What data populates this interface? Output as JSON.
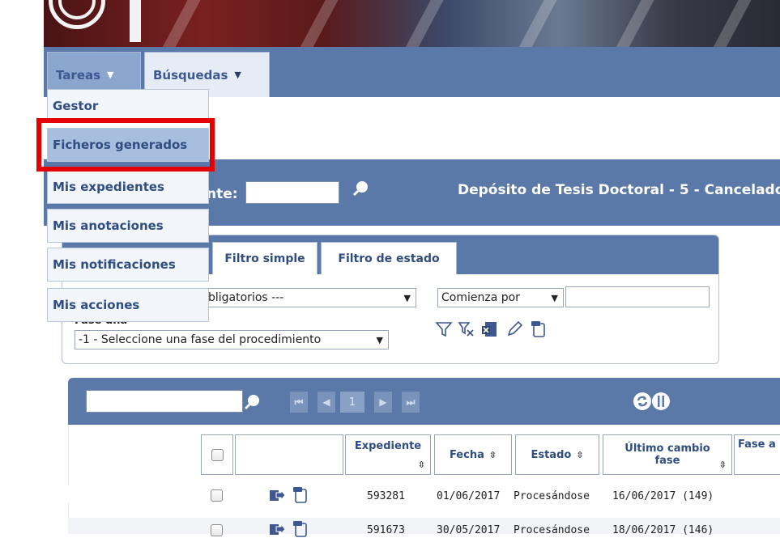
{
  "nav": {
    "tabs": [
      {
        "label": "Tareas"
      },
      {
        "label": "Búsquedas"
      }
    ],
    "caret": "▼"
  },
  "dropdown": {
    "items": [
      {
        "label": "Gestor"
      },
      {
        "label": "Ficheros generados"
      },
      {
        "label": "Mis expedientes"
      },
      {
        "label": "Mis anotaciones"
      },
      {
        "label": "Mis notificaciones"
      },
      {
        "label": "Mis acciones"
      }
    ],
    "highlighted_index": 1
  },
  "procedure": {
    "expediente_label_visible": "nte:",
    "expediente_value": "",
    "title": "Depósito de Tesis Doctoral - 5 - Cancelado"
  },
  "filters": {
    "tabs": [
      {
        "label": "Filtro simple"
      },
      {
        "label": "Filtro de estado"
      }
    ],
    "field_select": "bligatorios ---",
    "match_select": "Comienza por",
    "text_value": "",
    "fase_label": "Fase una",
    "fase_select": "-1 - Seleccione una fase del procedimiento",
    "icons": [
      "filter-icon",
      "clear-filter-icon",
      "excel-export-icon",
      "edit-icon",
      "new-document-icon"
    ]
  },
  "grid": {
    "search_value": "",
    "page": "1",
    "pager_icons": [
      "first-page-icon",
      "previous-page-icon",
      "next-page-icon",
      "last-page-icon"
    ],
    "columns": [
      {
        "label": "Expediente",
        "sortable": true
      },
      {
        "label": "Fecha",
        "sortable": true
      },
      {
        "label": "Estado",
        "sortable": true
      },
      {
        "label": "Último cambio fase",
        "sortable": true
      },
      {
        "label": "Fase a",
        "sortable": false
      }
    ],
    "sort_glyph": "⇳",
    "rows": [
      {
        "expediente": "593281",
        "fecha": "01/06/2017",
        "estado": "Procesándose",
        "ultimo_cambio": "16/06/2017 (149)"
      },
      {
        "expediente": "591673",
        "fecha": "30/05/2017",
        "estado": "Procesándose",
        "ultimo_cambio": "18/06/2017 (146)"
      }
    ]
  },
  "colors": {
    "brand_blue": "#5a78a8",
    "menu_text": "#2f4d80",
    "highlight_red": "#e50000"
  }
}
